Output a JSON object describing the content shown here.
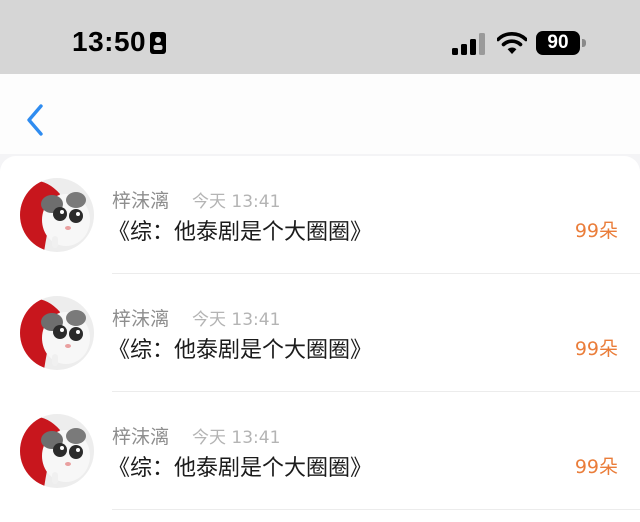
{
  "status_bar": {
    "time": "13:50",
    "battery": "90",
    "icons": [
      "id-card-icon",
      "signal-icon",
      "wifi-icon",
      "battery-icon"
    ]
  },
  "nav": {
    "back_icon": "chevron-left-icon",
    "accent_color": "#2f8cf0"
  },
  "items": [
    {
      "user": "梓沫漓",
      "time": "今天 13:41",
      "title": "《综：他泰剧是个大圈圈》",
      "count": "99朵"
    },
    {
      "user": "梓沫漓",
      "time": "今天 13:41",
      "title": "《综：他泰剧是个大圈圈》",
      "count": "99朵"
    },
    {
      "user": "梓沫漓",
      "time": "今天 13:41",
      "title": "《综：他泰剧是个大圈圈》",
      "count": "99朵"
    }
  ],
  "colors": {
    "count": "#ea7d3a",
    "username": "#8e8e8e",
    "timestamp": "#b4b4b4",
    "title": "#1b1b1b"
  }
}
